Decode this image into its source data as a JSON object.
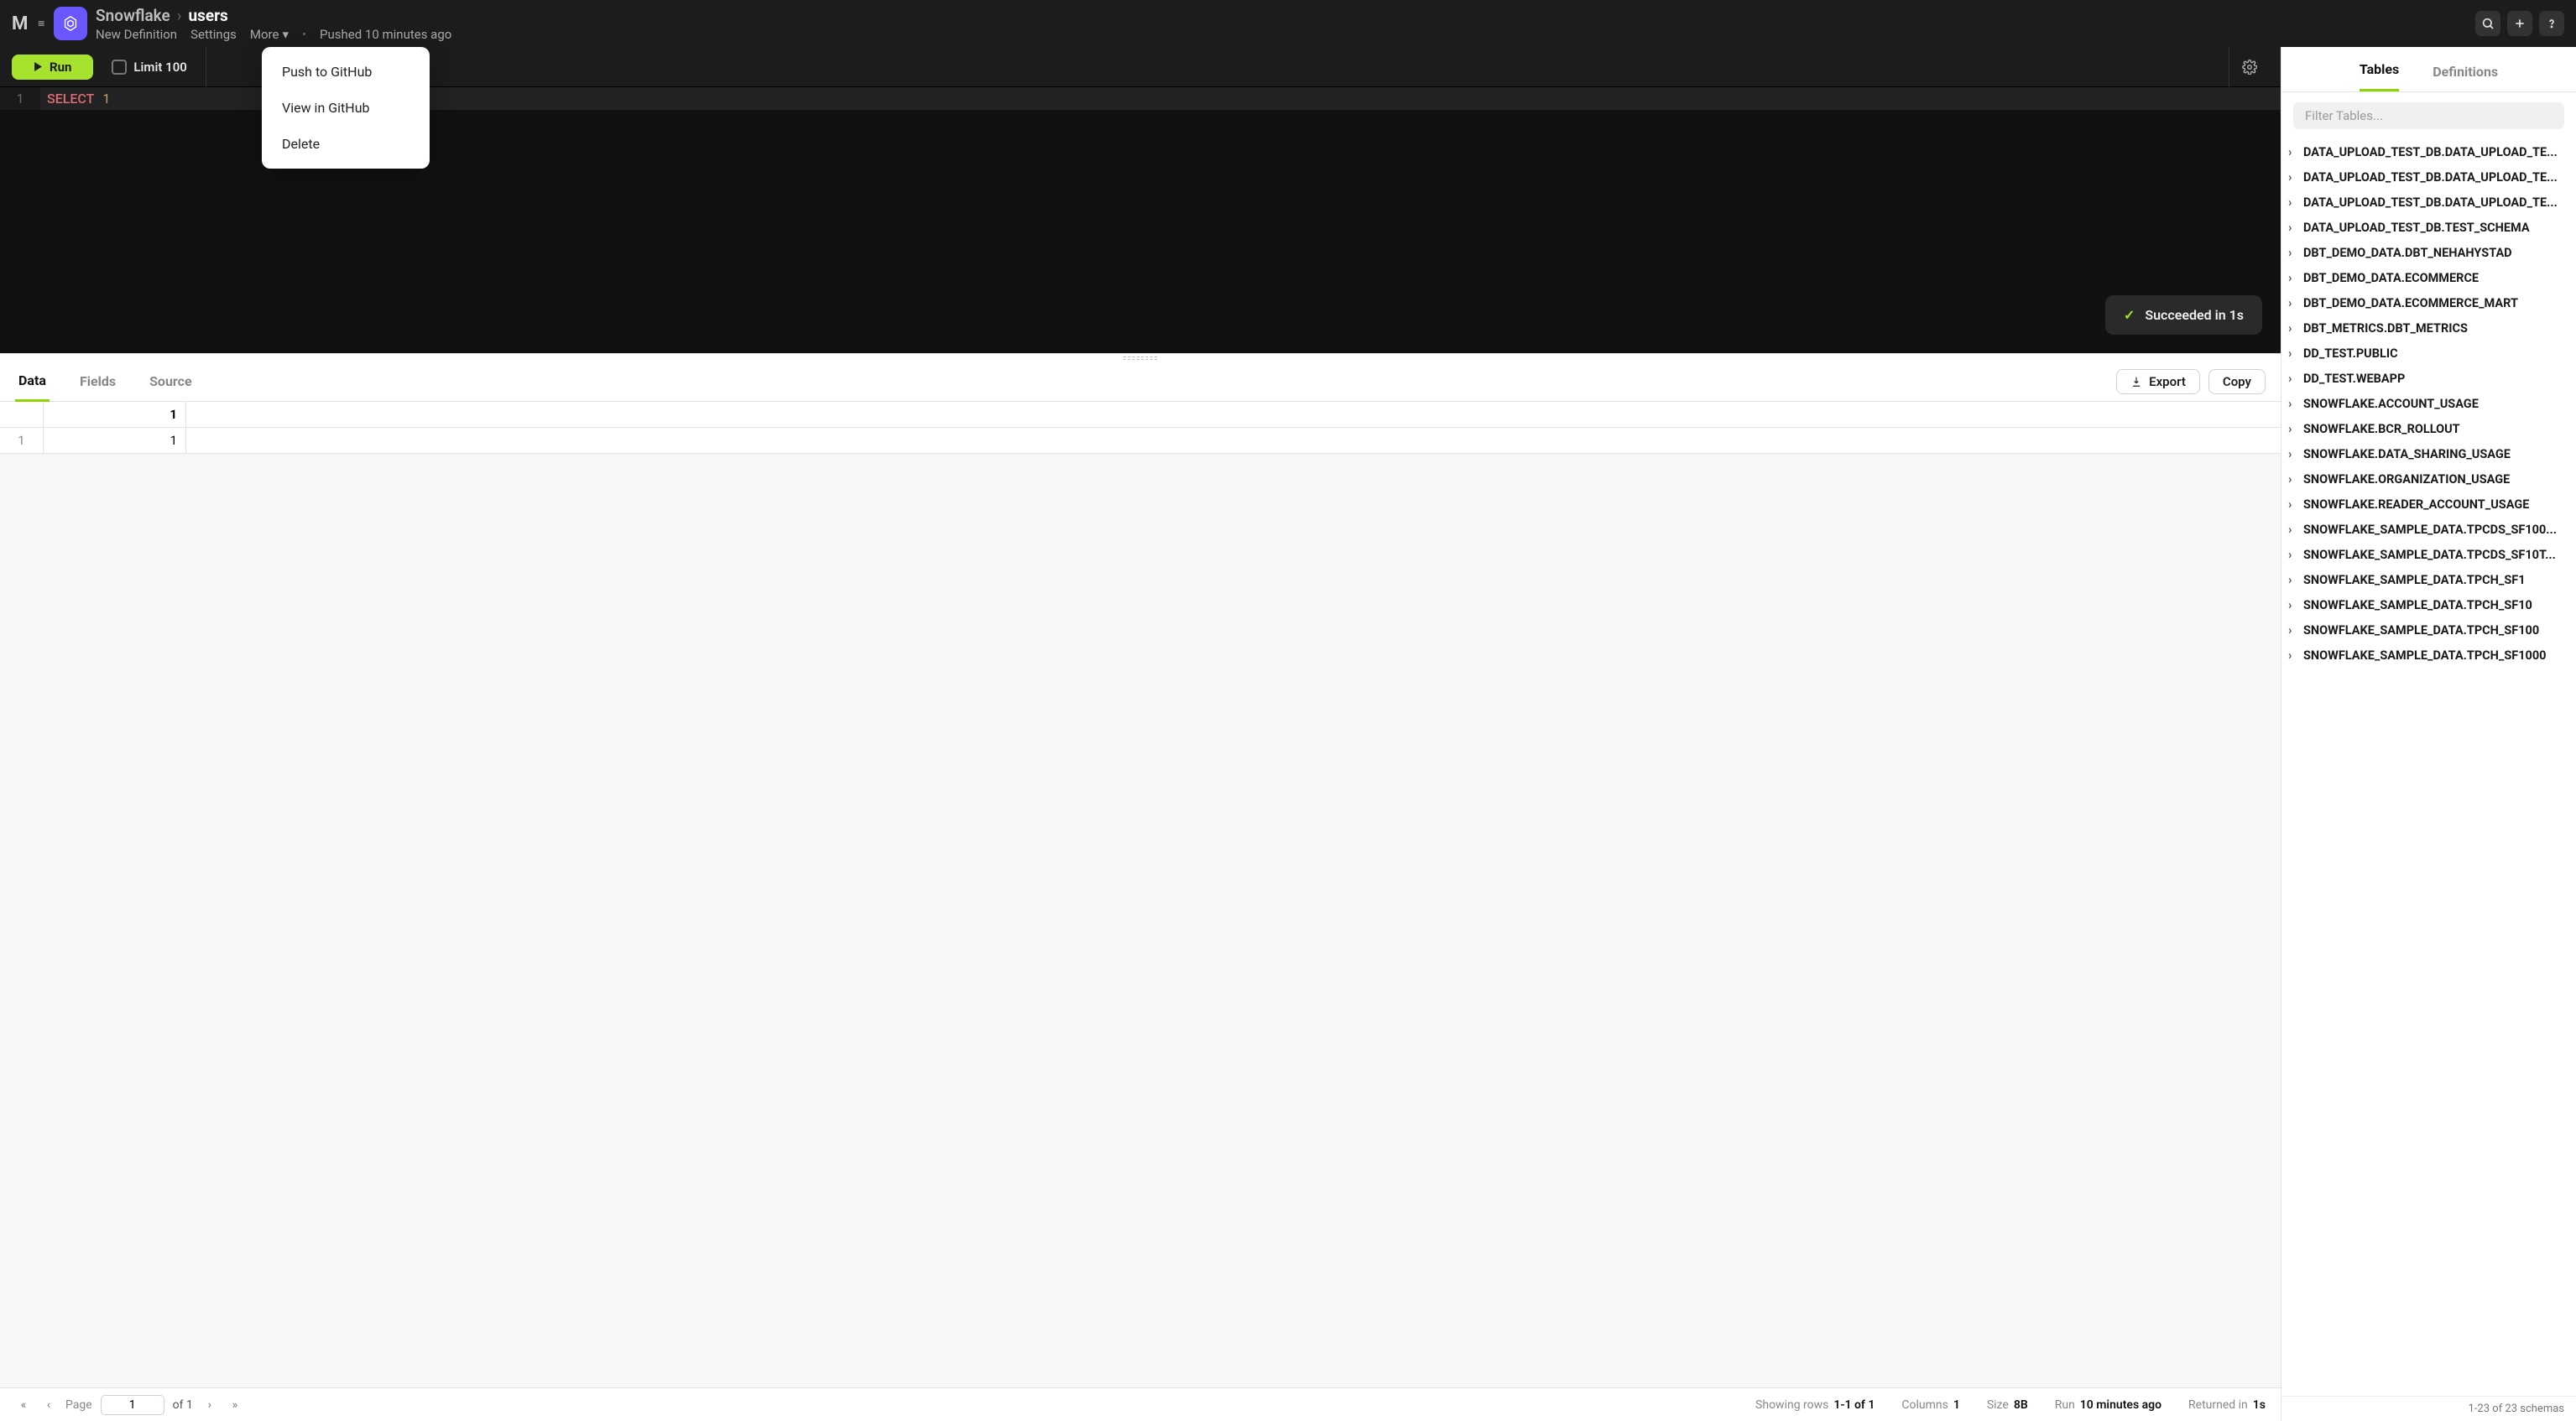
{
  "header": {
    "database": "Snowflake",
    "name": "users",
    "links": {
      "new_def": "New Definition",
      "settings": "Settings",
      "more": "More"
    },
    "status": "Pushed 10 minutes ago"
  },
  "toolbar": {
    "run": "Run",
    "limit": "Limit 100"
  },
  "dropdown": {
    "push": "Push to GitHub",
    "view": "View in GitHub",
    "delete": "Delete"
  },
  "editor": {
    "line_no": "1",
    "keyword": "SELECT",
    "value": "1"
  },
  "toast": "Succeeded in 1s",
  "results": {
    "tabs": {
      "data": "Data",
      "fields": "Fields",
      "source": "Source"
    },
    "export": "Export",
    "copy": "Copy",
    "col_header": "1",
    "row_idx": "1",
    "row_val": "1"
  },
  "footer": {
    "page_lbl": "Page",
    "page_val": "1",
    "page_of": "of 1",
    "showing_lbl": "Showing rows",
    "showing_val": "1-1 of 1",
    "cols_lbl": "Columns",
    "cols_val": "1",
    "size_lbl": "Size",
    "size_val": "8B",
    "run_lbl": "Run",
    "run_val": "10 minutes ago",
    "ret_lbl": "Returned in",
    "ret_val": "1s"
  },
  "side": {
    "tabs": {
      "tables": "Tables",
      "definitions": "Definitions"
    },
    "filter_placeholder": "Filter Tables...",
    "schemas": [
      "DATA_UPLOAD_TEST_DB.DATA_UPLOAD_TE...",
      "DATA_UPLOAD_TEST_DB.DATA_UPLOAD_TE...",
      "DATA_UPLOAD_TEST_DB.DATA_UPLOAD_TE...",
      "DATA_UPLOAD_TEST_DB.TEST_SCHEMA",
      "DBT_DEMO_DATA.DBT_NEHAHYSTAD",
      "DBT_DEMO_DATA.ECOMMERCE",
      "DBT_DEMO_DATA.ECOMMERCE_MART",
      "DBT_METRICS.DBT_METRICS",
      "DD_TEST.PUBLIC",
      "DD_TEST.WEBAPP",
      "SNOWFLAKE.ACCOUNT_USAGE",
      "SNOWFLAKE.BCR_ROLLOUT",
      "SNOWFLAKE.DATA_SHARING_USAGE",
      "SNOWFLAKE.ORGANIZATION_USAGE",
      "SNOWFLAKE.READER_ACCOUNT_USAGE",
      "SNOWFLAKE_SAMPLE_DATA.TPCDS_SF100...",
      "SNOWFLAKE_SAMPLE_DATA.TPCDS_SF10T...",
      "SNOWFLAKE_SAMPLE_DATA.TPCH_SF1",
      "SNOWFLAKE_SAMPLE_DATA.TPCH_SF10",
      "SNOWFLAKE_SAMPLE_DATA.TPCH_SF100",
      "SNOWFLAKE_SAMPLE_DATA.TPCH_SF1000"
    ],
    "footer": "1-23 of 23 schemas"
  }
}
